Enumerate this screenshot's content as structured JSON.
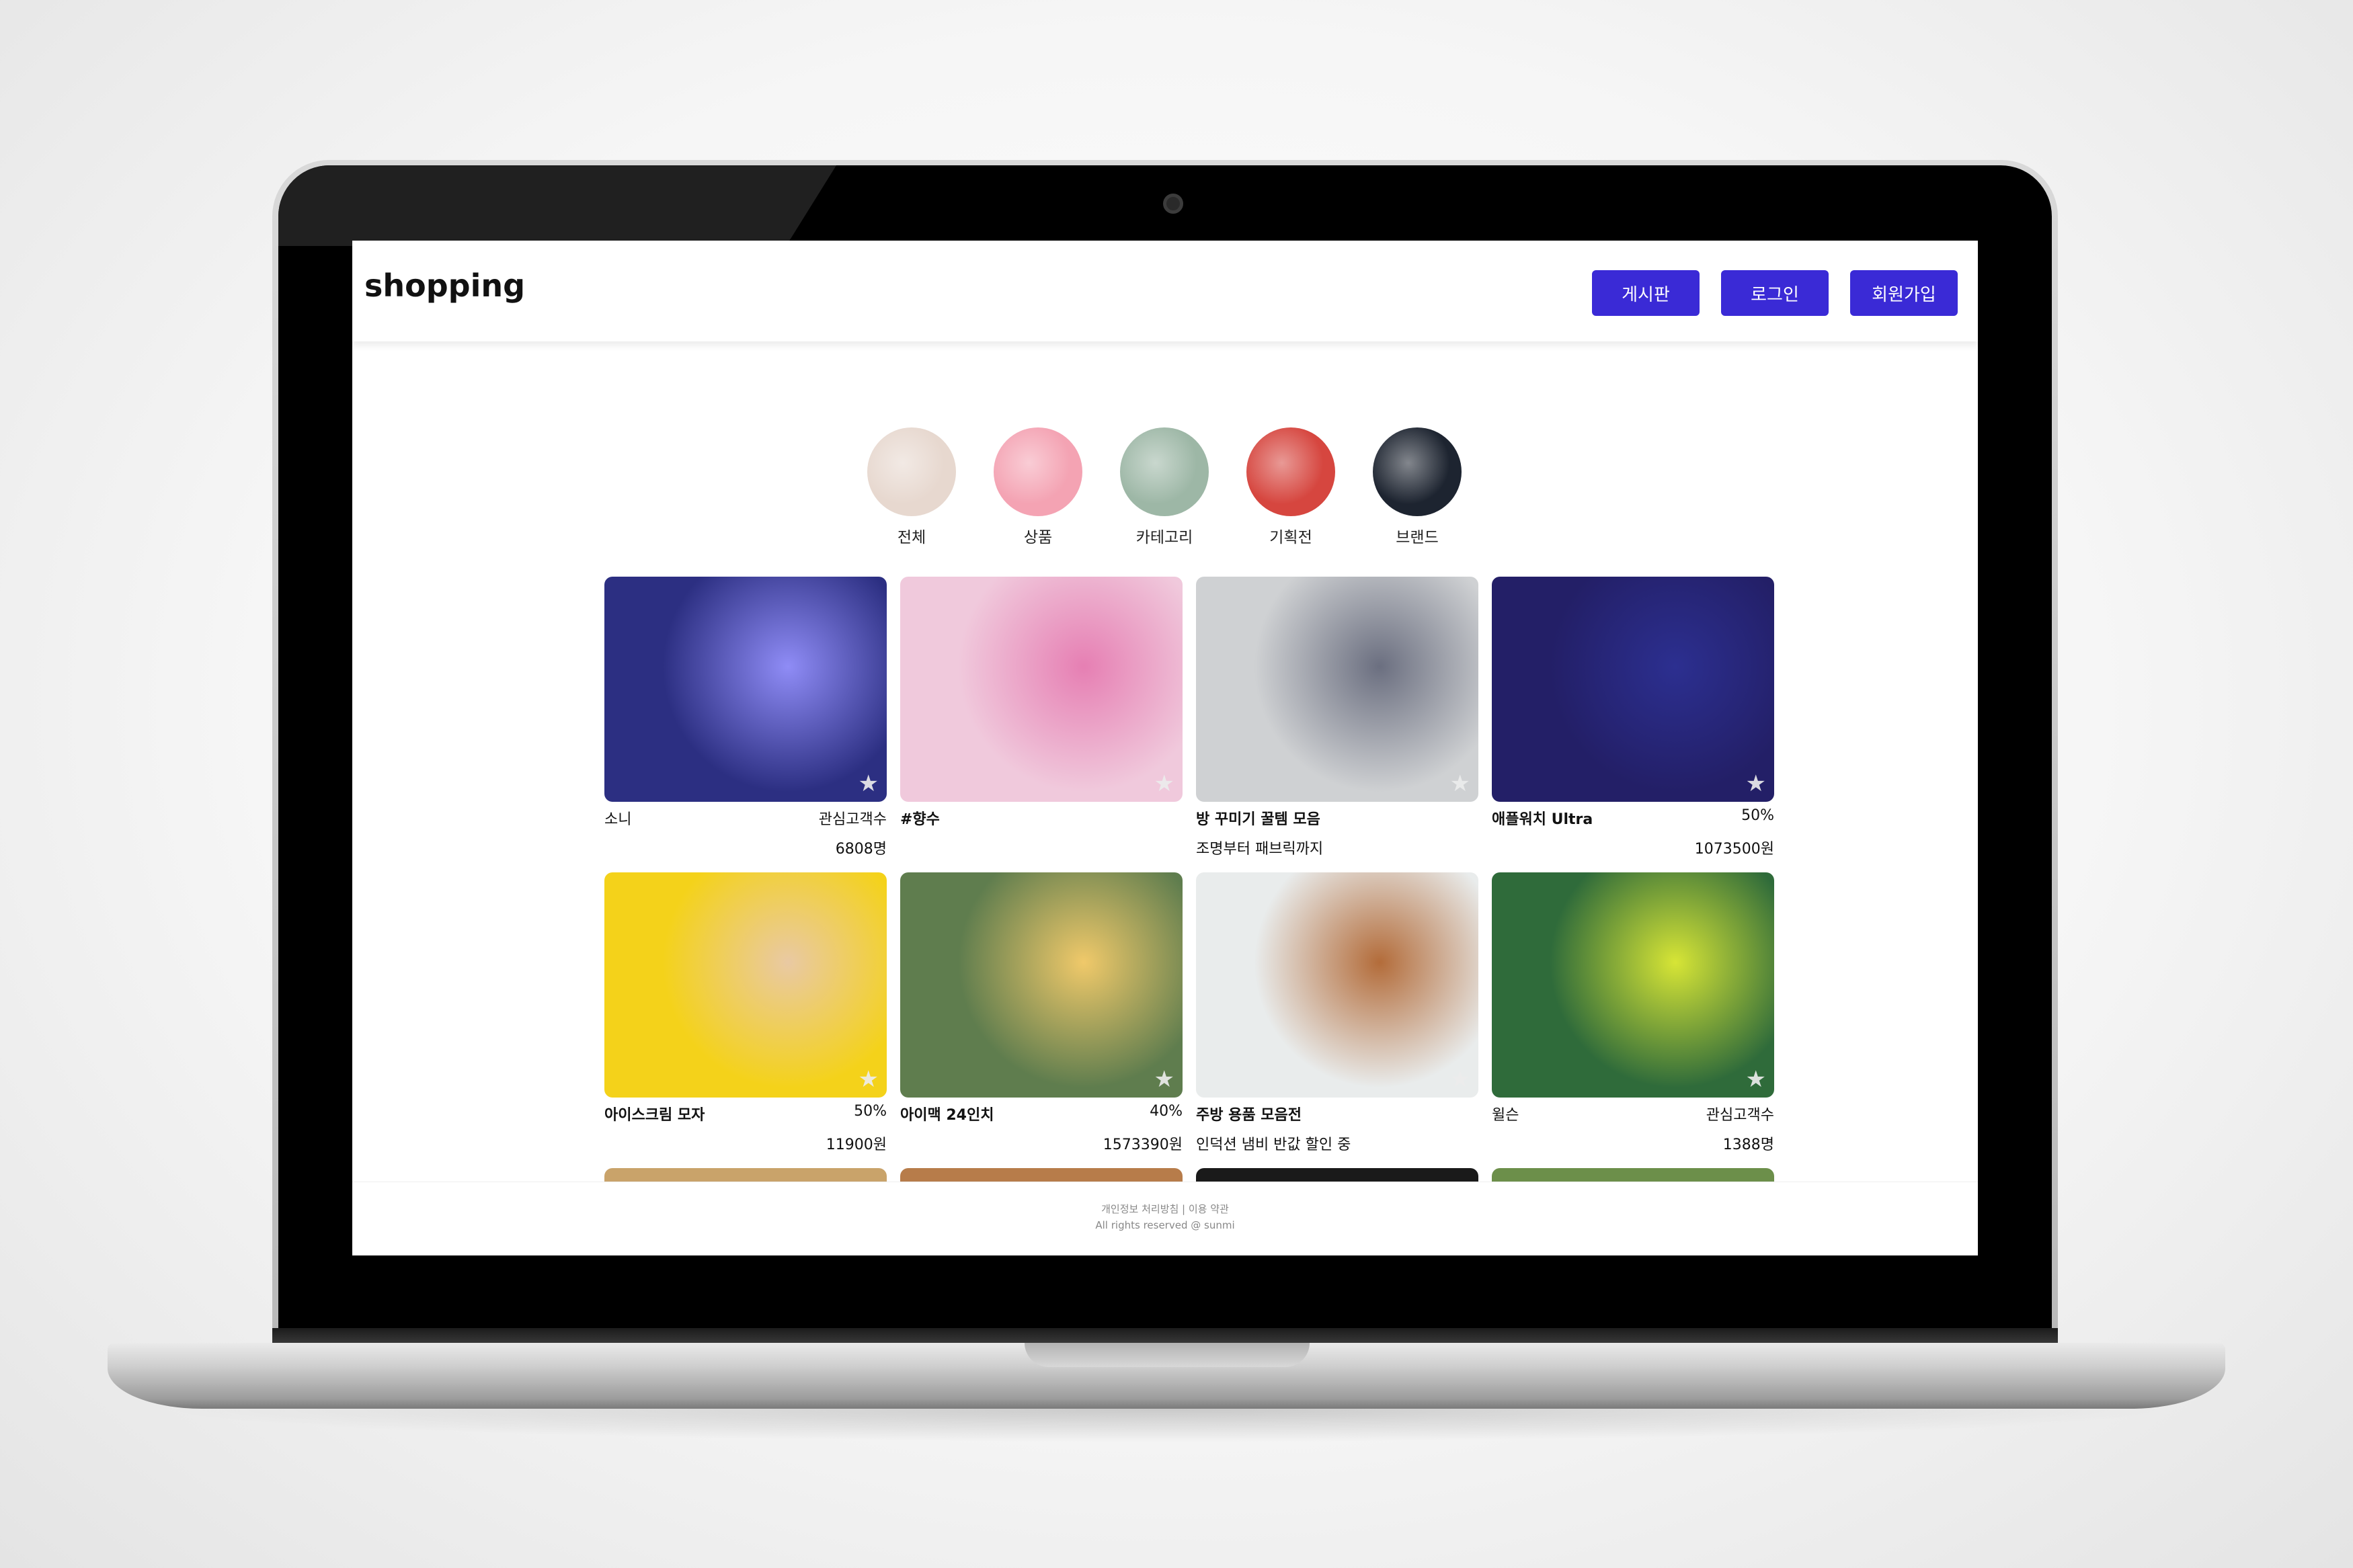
{
  "header": {
    "logo": "shopping",
    "nav": [
      "게시판",
      "로그인",
      "회원가입"
    ]
  },
  "categories": [
    {
      "label": "전체",
      "bg": "#e7d8cf"
    },
    {
      "label": "상품",
      "bg": "#f4a3b3"
    },
    {
      "label": "카테고리",
      "bg": "#9db7a6"
    },
    {
      "label": "기획전",
      "bg": "#d6463f"
    },
    {
      "label": "브랜드",
      "bg": "#1d2430"
    }
  ],
  "products": [
    {
      "title": "소니",
      "title_bold": false,
      "meta": "관심고객수",
      "sub": "6808명",
      "sub_align": "right",
      "bg": "#2c2f82",
      "accent": "#8f8cf6"
    },
    {
      "title": "#향수",
      "title_bold": true,
      "meta": "",
      "sub": "",
      "sub_align": "right",
      "bg": "#f0c9dc",
      "accent": "#e67fb3"
    },
    {
      "title": "방 꾸미기 꿀템 모음",
      "title_bold": true,
      "meta": "",
      "sub": "조명부터 패브릭까지",
      "sub_align": "left",
      "bg": "#cfd1d3",
      "accent": "#6b6f80"
    },
    {
      "title": "애플워치 Ultra",
      "title_bold": true,
      "meta": "50%",
      "sub": "1073500원",
      "sub_align": "right",
      "bg": "#231f67",
      "accent": "#2c2f90"
    },
    {
      "title": "아이스크림 모자",
      "title_bold": true,
      "meta": "50%",
      "sub": "11900원",
      "sub_align": "right",
      "bg": "#f4d21a",
      "accent": "#e9c9a3"
    },
    {
      "title": "아이맥 24인치",
      "title_bold": true,
      "meta": "40%",
      "sub": "1573390원",
      "sub_align": "right",
      "bg": "#5f7d4e",
      "accent": "#f0c96a"
    },
    {
      "title": "주방 용품 모음전",
      "title_bold": true,
      "meta": "",
      "sub": "인덕션 냄비 반값 할인 중",
      "sub_align": "left",
      "bg": "#e9ecec",
      "accent": "#b36c3a"
    },
    {
      "title": "윌슨",
      "title_bold": false,
      "meta": "관심고객수",
      "sub": "1388명",
      "sub_align": "right",
      "bg": "#2f6b3a",
      "accent": "#d7e536"
    }
  ],
  "partial_row_colors": [
    "#c9a36a",
    "#b77c4a",
    "#1a1a1a",
    "#6c8f4a"
  ],
  "footer": {
    "line1": "개인정보 처리방침 | 이용 약관",
    "line2": "All rights reserved @ sunmi"
  }
}
